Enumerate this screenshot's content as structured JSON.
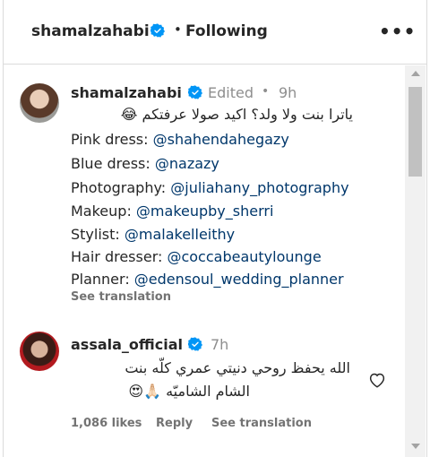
{
  "header": {
    "username": "shamalzahabi",
    "separator": "•",
    "follow_status": "Following",
    "more": "•••"
  },
  "comments": [
    {
      "username": "shamalzahabi",
      "edited": "Edited",
      "separator": "•",
      "time": "9h",
      "text_arabic": "ياترا بنت ولا ولد؟ اكيد صولا عرفتكم 😂",
      "credits": [
        {
          "label": "Pink dress: ",
          "handle": "@shahendahegazy"
        },
        {
          "label": "Blue dress: ",
          "handle": "@nazazy"
        },
        {
          "label": "Photography: ",
          "handle": "@juliahany_photography"
        },
        {
          "label": "Makeup: ",
          "handle": "@makeupby_sherri"
        },
        {
          "label": "Stylist: ",
          "handle": "@malakelleithy"
        },
        {
          "label": "Hair dresser: ",
          "handle": "@coccabeautylounge"
        },
        {
          "label": "Planner: ",
          "handle": "@edensoul_wedding_planner"
        }
      ],
      "see_translation": "See translation"
    },
    {
      "username": "assala_official",
      "time": "7h",
      "text_line1": "الله يحفظ روحي دنيتي عمري كلّه بنت",
      "text_line2": "الشام الشاميّه 🙏🏻😍",
      "likes": "1,086 likes",
      "reply": "Reply",
      "see_translation": "See translation"
    }
  ],
  "colors": {
    "verified": "#0095f6",
    "mention": "#00376b",
    "secondary_text": "#8e8e8e"
  }
}
